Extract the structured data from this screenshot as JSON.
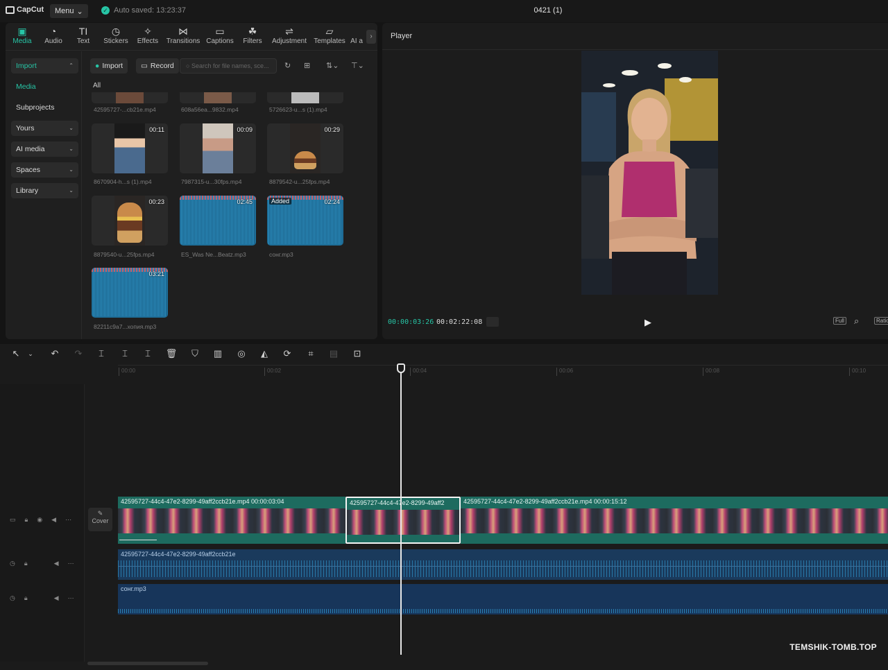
{
  "app": {
    "name": "CapCut",
    "menu_label": "Menu",
    "autosave": "Auto saved: 13:23:37",
    "project_title": "0421 (1)"
  },
  "tabs": [
    {
      "label": "Media",
      "icon": "▣"
    },
    {
      "label": "Audio",
      "icon": "◔"
    },
    {
      "label": "Text",
      "icon": "TI"
    },
    {
      "label": "Stickers",
      "icon": "◷"
    },
    {
      "label": "Effects",
      "icon": "✧"
    },
    {
      "label": "Transitions",
      "icon": "⋈"
    },
    {
      "label": "Captions",
      "icon": "▭"
    },
    {
      "label": "Filters",
      "icon": "☘"
    },
    {
      "label": "Adjustment",
      "icon": "⇌"
    },
    {
      "label": "Templates",
      "icon": "▱"
    },
    {
      "label": "AI a",
      "icon": ""
    }
  ],
  "sidenav": {
    "import": "Import",
    "media": "Media",
    "subprojects": "Subprojects",
    "yours": "Yours",
    "ai_media": "AI media",
    "spaces": "Spaces",
    "library": "Library"
  },
  "media_bar": {
    "import": "Import",
    "record": "Record",
    "search_placeholder": "Search for file names, sce..."
  },
  "all_label": "All",
  "media_items": [
    {
      "name": "42595727-...cb21e.mp4",
      "duration": "",
      "kind": "video"
    },
    {
      "name": "608a56ea...9832.mp4",
      "duration": "",
      "kind": "video"
    },
    {
      "name": "5726623-u...s (1).mp4",
      "duration": "",
      "kind": "video"
    },
    {
      "name": "8670904-h...s (1).mp4",
      "duration": "00:11",
      "kind": "video"
    },
    {
      "name": "7987315-u...30fps.mp4",
      "duration": "00:09",
      "kind": "video"
    },
    {
      "name": "8879542-u...25fps.mp4",
      "duration": "00:29",
      "kind": "video"
    },
    {
      "name": "8879540-u...25fps.mp4",
      "duration": "00:23",
      "kind": "video"
    },
    {
      "name": "ES_Was Ne...Beatz.mp3",
      "duration": "02:45",
      "kind": "audio"
    },
    {
      "name": "сонг.mp3",
      "duration": "02:24",
      "kind": "audio",
      "badge": "Added"
    },
    {
      "name": "82211c9a7...хопия.mp3",
      "duration": "03:21",
      "kind": "audio"
    }
  ],
  "player": {
    "label": "Player",
    "current_time": "00:00:03:26",
    "total_time": "00:02:22:08",
    "full_label": "Full",
    "ratio_label": "Ratio"
  },
  "ruler": [
    "00:00",
    "00:02",
    "00:04",
    "00:06",
    "00:08",
    "00:10"
  ],
  "timeline": {
    "cover_label": "Cover",
    "video_clips": [
      {
        "label": "42595727-44c4-47e2-8299-49aff2ccb21e.mp4   00:00:03:04"
      },
      {
        "label": "42595727-44c4-47e2-8299-49aff2"
      },
      {
        "label": "42595727-44c4-47e2-8299-49aff2ccb21e.mp4   00:00:15:12"
      }
    ],
    "audio_clips": [
      {
        "label": "42595727-44c4-47e2-8299-49aff2ccb21e"
      },
      {
        "label": "сонг.mp3"
      }
    ]
  },
  "watermark": "TEMSHIK-TOMB.TOP",
  "colors": {
    "accent": "#27c5a6",
    "video_track": "#1d6b5f",
    "audio_track": "#1a3a5c"
  }
}
